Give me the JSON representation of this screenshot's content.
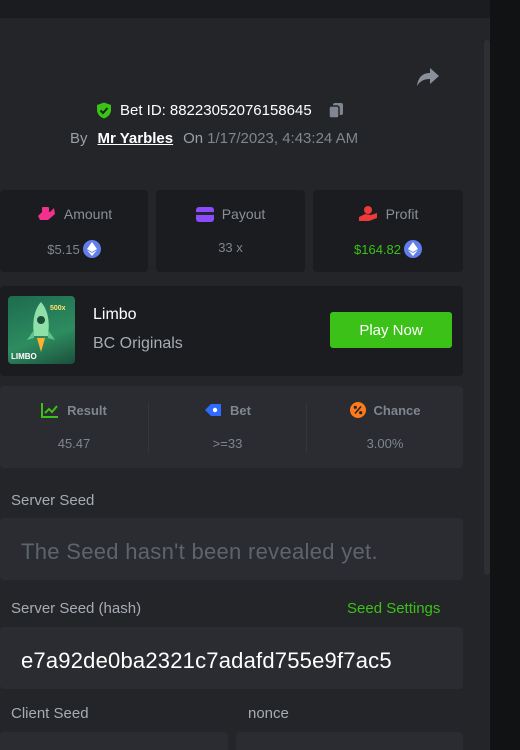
{
  "bet": {
    "id_label": "Bet ID:",
    "id": "88223052076158645",
    "by_label": "By",
    "user": "Mr Yarbles",
    "on_label": "On",
    "timestamp": "1/17/2023, 4:43:24 AM"
  },
  "stats": {
    "amount": {
      "label": "Amount",
      "value": "$5.15",
      "icon": "money-hand-icon",
      "color": "#f4308d"
    },
    "payout": {
      "label": "Payout",
      "value": "33 x",
      "icon": "wallet-card-icon",
      "color": "#8c4bff"
    },
    "profit": {
      "label": "Profit",
      "value": "$164.82",
      "icon": "profit-hand-icon",
      "color": "#ee3a3a"
    }
  },
  "game": {
    "title": "Limbo",
    "provider": "BC Originals",
    "play_label": "Play Now",
    "thumb_badge": "LIMBO",
    "thumb_mult": "500x"
  },
  "result": {
    "result": {
      "label": "Result",
      "value": "45.47"
    },
    "bet": {
      "label": "Bet",
      "value": ">=33"
    },
    "chance": {
      "label": "Chance",
      "value": "3.00%"
    }
  },
  "seeds": {
    "server_seed_label": "Server Seed",
    "server_seed_value": "The Seed hasn't been revealed yet.",
    "server_hash_label": "Server Seed (hash)",
    "seed_settings_label": "Seed Settings",
    "server_hash_value": "e7a92de0ba2321c7adafd755e9f7ac5",
    "client_seed_label": "Client Seed",
    "nonce_label": "nonce"
  },
  "colors": {
    "accent_green": "#3bc117",
    "eth_blue": "#627eea",
    "bet_blue": "#2f6bff",
    "chance_orange": "#ff7a1a"
  }
}
